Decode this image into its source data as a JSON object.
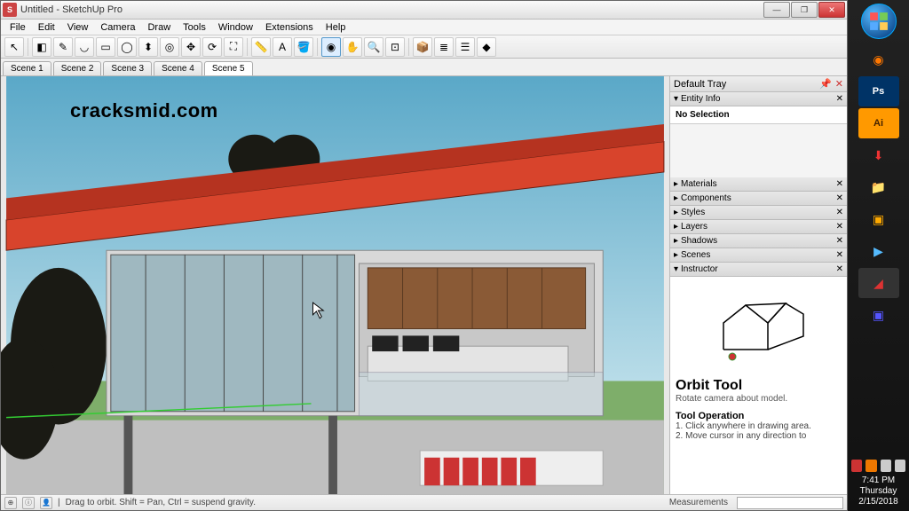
{
  "window": {
    "title": "Untitled - SketchUp Pro",
    "minimize": "—",
    "maximize": "❐",
    "close": "✕"
  },
  "menus": [
    "File",
    "Edit",
    "View",
    "Camera",
    "Draw",
    "Tools",
    "Window",
    "Extensions",
    "Help"
  ],
  "toolbar_icons": {
    "select": "↖",
    "eraser": "◧",
    "pencil": "✎",
    "arc": "◡",
    "rect": "▭",
    "circle": "◯",
    "pushpull": "⬍",
    "offset": "◎",
    "move": "✥",
    "rotate": "⟳",
    "scale": "⛶",
    "tape": "📏",
    "text": "A",
    "paint": "🪣",
    "orbit": "◉",
    "pan": "✋",
    "zoom": "🔍",
    "zoomext": "⊡",
    "warehouse": "📦",
    "layers": "≣",
    "outliner": "☰",
    "ruby": "◆"
  },
  "scenes": [
    "Scene 1",
    "Scene 2",
    "Scene 3",
    "Scene 4",
    "Scene 5"
  ],
  "active_scene": 4,
  "tray": {
    "title": "Default Tray",
    "entity_info": {
      "title": "Entity Info",
      "content": "No Selection"
    },
    "panels": [
      "Materials",
      "Components",
      "Styles",
      "Layers",
      "Shadows",
      "Scenes",
      "Instructor"
    ]
  },
  "instructor": {
    "title": "Orbit Tool",
    "subtitle": "Rotate camera about model.",
    "op_heading": "Tool Operation",
    "op1": "1. Click anywhere in drawing area.",
    "op2": "2. Move cursor in any direction to"
  },
  "status": {
    "hint": "Drag to orbit. Shift = Pan, Ctrl = suspend gravity.",
    "measurements_label": "Measurements"
  },
  "watermark": "cracksmid.com",
  "system": {
    "time": "7:41 PM",
    "day": "Thursday",
    "date": "2/15/2018"
  },
  "colors": {
    "roof": "#d8442c",
    "wood": "#8a5a36",
    "sky": "#7bb8d0",
    "grass": "#7eae6a"
  }
}
